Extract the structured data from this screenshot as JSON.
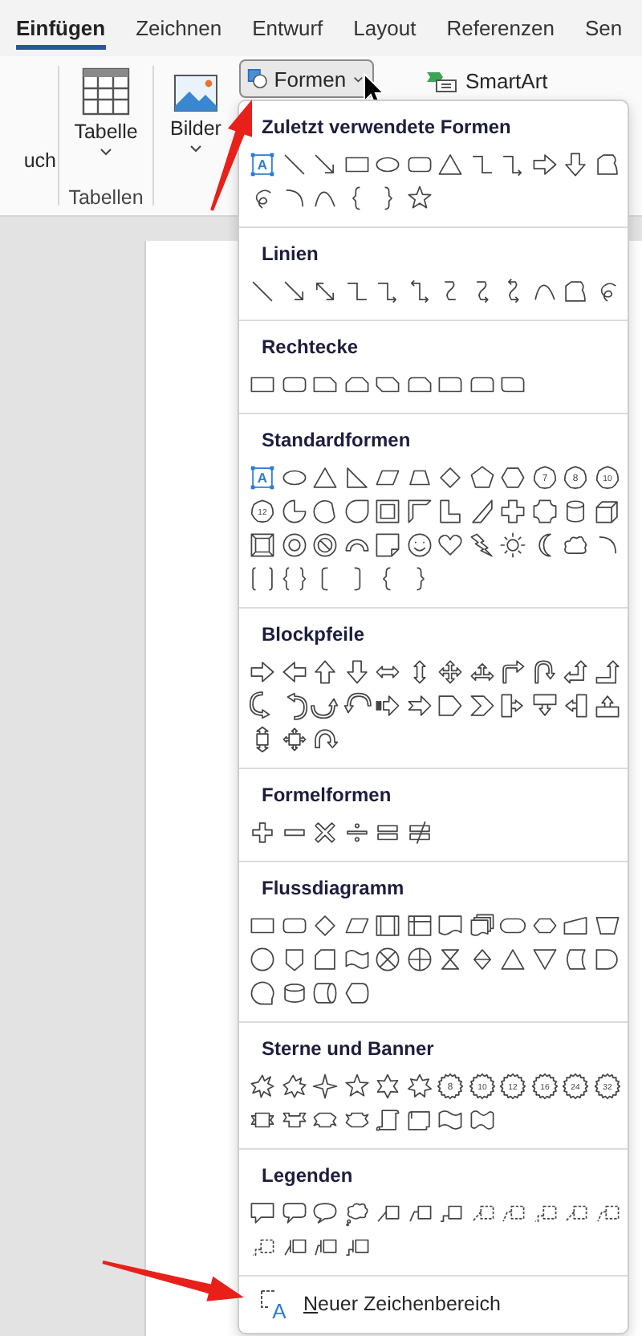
{
  "ribbon": {
    "tabs": [
      {
        "label": "Einfügen",
        "selected": true
      },
      {
        "label": "Zeichnen",
        "selected": false
      },
      {
        "label": "Entwurf",
        "selected": false
      },
      {
        "label": "Layout",
        "selected": false
      },
      {
        "label": "Referenzen",
        "selected": false
      },
      {
        "label": "Sen",
        "selected": false
      }
    ],
    "cut_label": "uch",
    "table": {
      "label": "Tabelle",
      "group_label": "Tabellen"
    },
    "pictures": {
      "label": "Bilder"
    },
    "shapes_button": {
      "label": "Formen",
      "expanded": true
    },
    "smartart_button": {
      "label": "SmartArt"
    }
  },
  "shapes_menu": {
    "sections": [
      {
        "title": "Zuletzt verwendete Formen",
        "shapes": [
          {
            "kind": "textbox",
            "label": "A"
          },
          {
            "kind": "line"
          },
          {
            "kind": "arrow-line"
          },
          {
            "kind": "rect"
          },
          {
            "kind": "ellipse"
          },
          {
            "kind": "round-rect"
          },
          {
            "kind": "triangle"
          },
          {
            "kind": "elbow"
          },
          {
            "kind": "elbow-arrow"
          },
          {
            "kind": "arrow-right"
          },
          {
            "kind": "arrow-down"
          },
          {
            "kind": "freeform"
          },
          {
            "kind": "scribble"
          },
          {
            "kind": "arc"
          },
          {
            "kind": "curve"
          },
          {
            "kind": "brace-left"
          },
          {
            "kind": "brace-right"
          },
          {
            "kind": "star5"
          }
        ]
      },
      {
        "title": "Linien",
        "shapes": [
          {
            "kind": "line"
          },
          {
            "kind": "arrow-line"
          },
          {
            "kind": "double-arrow-line"
          },
          {
            "kind": "elbow"
          },
          {
            "kind": "elbow-arrow"
          },
          {
            "kind": "elbow-double-arrow"
          },
          {
            "kind": "curve-connector"
          },
          {
            "kind": "curve-arrow"
          },
          {
            "kind": "curve-double-arrow"
          },
          {
            "kind": "curve"
          },
          {
            "kind": "freeform"
          },
          {
            "kind": "scribble"
          }
        ]
      },
      {
        "title": "Rechtecke",
        "shapes": [
          {
            "kind": "rect"
          },
          {
            "kind": "round-rect"
          },
          {
            "kind": "snip-rect"
          },
          {
            "kind": "snip-same"
          },
          {
            "kind": "snip-diag"
          },
          {
            "kind": "snip-round"
          },
          {
            "kind": "round-one"
          },
          {
            "kind": "round-same"
          },
          {
            "kind": "round-diag"
          }
        ]
      },
      {
        "title": "Standardformen",
        "shapes": [
          {
            "kind": "textbox",
            "label": "A"
          },
          {
            "kind": "ellipse"
          },
          {
            "kind": "triangle"
          },
          {
            "kind": "right-triangle"
          },
          {
            "kind": "parallelogram"
          },
          {
            "kind": "trapezoid"
          },
          {
            "kind": "diamond"
          },
          {
            "kind": "pentagon"
          },
          {
            "kind": "hexagon"
          },
          {
            "kind": "numbered-polygon",
            "label": "7"
          },
          {
            "kind": "numbered-polygon",
            "label": "8"
          },
          {
            "kind": "numbered-polygon",
            "label": "10"
          },
          {
            "kind": "numbered-polygon",
            "label": "12"
          },
          {
            "kind": "pie"
          },
          {
            "kind": "chord"
          },
          {
            "kind": "teardrop"
          },
          {
            "kind": "frame"
          },
          {
            "kind": "half-frame"
          },
          {
            "kind": "l-shape"
          },
          {
            "kind": "diag-stripe"
          },
          {
            "kind": "plus"
          },
          {
            "kind": "plaque"
          },
          {
            "kind": "cylinder"
          },
          {
            "kind": "cube"
          },
          {
            "kind": "bevel"
          },
          {
            "kind": "donut"
          },
          {
            "kind": "no-symbol"
          },
          {
            "kind": "block-arc"
          },
          {
            "kind": "folded-corner"
          },
          {
            "kind": "smiley"
          },
          {
            "kind": "heart"
          },
          {
            "kind": "bolt"
          },
          {
            "kind": "sun"
          },
          {
            "kind": "moon"
          },
          {
            "kind": "cloud"
          },
          {
            "kind": "arc"
          },
          {
            "kind": "bracket-pair"
          },
          {
            "kind": "brace-pair"
          },
          {
            "kind": "bracket-left"
          },
          {
            "kind": "bracket-right"
          },
          {
            "kind": "brace-left"
          },
          {
            "kind": "brace-right"
          }
        ]
      },
      {
        "title": "Blockpfeile",
        "shapes": [
          {
            "kind": "arrow-right"
          },
          {
            "kind": "arrow-left"
          },
          {
            "kind": "arrow-up"
          },
          {
            "kind": "arrow-down"
          },
          {
            "kind": "arrow-left-right"
          },
          {
            "kind": "arrow-up-down"
          },
          {
            "kind": "quad-arrow"
          },
          {
            "kind": "left-right-up-arrow"
          },
          {
            "kind": "bent-arrow"
          },
          {
            "kind": "u-turn-arrow"
          },
          {
            "kind": "left-up-arrow"
          },
          {
            "kind": "bent-up-arrow"
          },
          {
            "kind": "curved-right-arrow"
          },
          {
            "kind": "curved-left-arrow"
          },
          {
            "kind": "curved-up-arrow"
          },
          {
            "kind": "curved-down-arrow"
          },
          {
            "kind": "striped-arrow"
          },
          {
            "kind": "notched-arrow"
          },
          {
            "kind": "pentagon-arrow"
          },
          {
            "kind": "chevron"
          },
          {
            "kind": "callout-right"
          },
          {
            "kind": "callout-down"
          },
          {
            "kind": "callout-left"
          },
          {
            "kind": "callout-up"
          },
          {
            "kind": "callout-up-down"
          },
          {
            "kind": "callout-quad"
          },
          {
            "kind": "circular-arrow"
          }
        ]
      },
      {
        "title": "Formelformen",
        "shapes": [
          {
            "kind": "math-plus"
          },
          {
            "kind": "math-minus"
          },
          {
            "kind": "math-multiply"
          },
          {
            "kind": "math-divide"
          },
          {
            "kind": "math-equal"
          },
          {
            "kind": "math-not-equal"
          }
        ]
      },
      {
        "title": "Flussdiagramm",
        "shapes": [
          {
            "kind": "rect"
          },
          {
            "kind": "round-rect"
          },
          {
            "kind": "diamond"
          },
          {
            "kind": "parallelogram"
          },
          {
            "kind": "predefined-process"
          },
          {
            "kind": "internal-storage"
          },
          {
            "kind": "document"
          },
          {
            "kind": "multidocument"
          },
          {
            "kind": "terminator"
          },
          {
            "kind": "preparation"
          },
          {
            "kind": "manual-input"
          },
          {
            "kind": "manual-operation"
          },
          {
            "kind": "connector"
          },
          {
            "kind": "offpage-connector"
          },
          {
            "kind": "card"
          },
          {
            "kind": "punched-tape"
          },
          {
            "kind": "summing-junction"
          },
          {
            "kind": "or"
          },
          {
            "kind": "collate"
          },
          {
            "kind": "sort"
          },
          {
            "kind": "extract"
          },
          {
            "kind": "merge"
          },
          {
            "kind": "stored-data"
          },
          {
            "kind": "delay"
          },
          {
            "kind": "sequential-access"
          },
          {
            "kind": "magnetic-disk"
          },
          {
            "kind": "direct-access"
          },
          {
            "kind": "display"
          }
        ]
      },
      {
        "title": "Sterne und Banner",
        "shapes": [
          {
            "kind": "explosion"
          },
          {
            "kind": "explosion-alt"
          },
          {
            "kind": "star4"
          },
          {
            "kind": "star5"
          },
          {
            "kind": "star6"
          },
          {
            "kind": "star7"
          },
          {
            "kind": "numbered-star",
            "label": "8"
          },
          {
            "kind": "numbered-star",
            "label": "10"
          },
          {
            "kind": "numbered-star",
            "label": "12"
          },
          {
            "kind": "numbered-star",
            "label": "16"
          },
          {
            "kind": "numbered-star",
            "label": "24"
          },
          {
            "kind": "numbered-star",
            "label": "32"
          },
          {
            "kind": "ribbon-down"
          },
          {
            "kind": "ribbon-up"
          },
          {
            "kind": "curved-ribbon-down"
          },
          {
            "kind": "curved-ribbon-up"
          },
          {
            "kind": "scroll-vertical"
          },
          {
            "kind": "scroll-horizontal"
          },
          {
            "kind": "wave"
          },
          {
            "kind": "double-wave"
          }
        ]
      },
      {
        "title": "Legenden",
        "shapes": [
          {
            "kind": "speech-rect"
          },
          {
            "kind": "speech-round"
          },
          {
            "kind": "speech-oval"
          },
          {
            "kind": "thought-cloud"
          },
          {
            "kind": "line-callout"
          },
          {
            "kind": "line-callout-bent"
          },
          {
            "kind": "line-callout-elbow"
          },
          {
            "kind": "line-callout-dashed"
          },
          {
            "kind": "line-callout-bent-dashed"
          },
          {
            "kind": "line-callout-elbow-dashed"
          },
          {
            "kind": "line-callout-dashed"
          },
          {
            "kind": "line-callout-bent-dashed"
          },
          {
            "kind": "line-callout-elbow-dashed"
          },
          {
            "kind": "line-callout-accent"
          },
          {
            "kind": "line-callout-bent-accent"
          },
          {
            "kind": "line-callout-elbow-accent"
          }
        ]
      }
    ],
    "footer": {
      "icon_label": "A",
      "label": "Neuer Zeichenbereich"
    }
  }
}
